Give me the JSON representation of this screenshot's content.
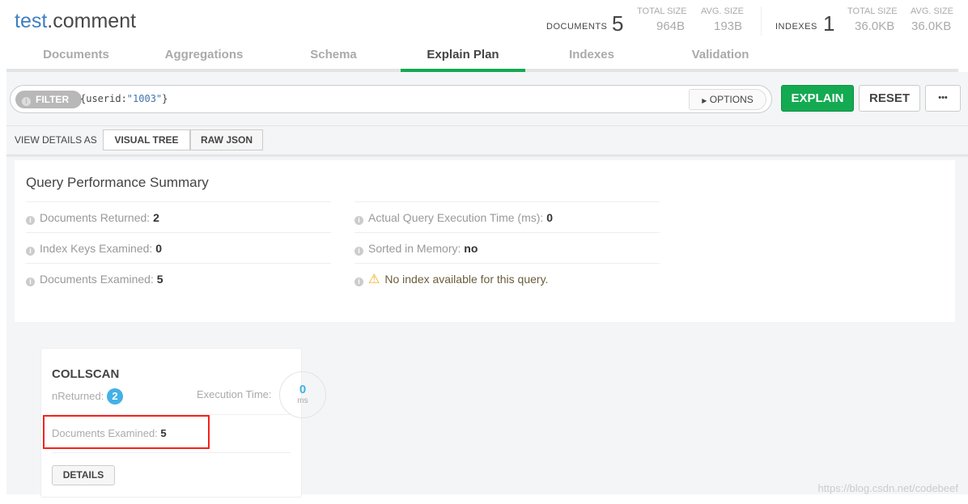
{
  "header": {
    "db": "test",
    "collection": ".comment",
    "documents": {
      "label": "DOCUMENTS",
      "count": "5",
      "total_size_label": "TOTAL SIZE",
      "total_size": "964B",
      "avg_size_label": "AVG. SIZE",
      "avg_size": "193B"
    },
    "indexes": {
      "label": "INDEXES",
      "count": "1",
      "total_size_label": "TOTAL SIZE",
      "total_size": "36.0KB",
      "avg_size_label": "AVG. SIZE",
      "avg_size": "36.0KB"
    }
  },
  "tabs": [
    {
      "label": "Documents"
    },
    {
      "label": "Aggregations"
    },
    {
      "label": "Schema"
    },
    {
      "label": "Explain Plan",
      "active": true
    },
    {
      "label": "Indexes"
    },
    {
      "label": "Validation"
    }
  ],
  "filter": {
    "badge": "FILTER",
    "value_pre": "{userid:",
    "value_str": "\"1003\"",
    "value_post": "}",
    "options": "OPTIONS"
  },
  "buttons": {
    "explain": "EXPLAIN",
    "reset": "RESET",
    "more": "•••"
  },
  "view": {
    "label": "VIEW DETAILS AS",
    "visual_tree": "VISUAL TREE",
    "raw_json": "RAW JSON"
  },
  "summary": {
    "title": "Query Performance Summary",
    "left": [
      {
        "label": "Documents Returned:",
        "value": "2"
      },
      {
        "label": "Index Keys Examined:",
        "value": "0"
      },
      {
        "label": "Documents Examined:",
        "value": "5"
      }
    ],
    "right": [
      {
        "label": "Actual Query Execution Time (ms):",
        "value": "0"
      },
      {
        "label": "Sorted in Memory:",
        "value": "no"
      }
    ],
    "warning": "No index available for this query."
  },
  "stage": {
    "name": "COLLSCAN",
    "nreturned_label": "nReturned:",
    "nreturned": "2",
    "exec_label": "Execution Time:",
    "exec_value": "0",
    "exec_unit": "ms",
    "docs_examined_label": "Documents Examined:",
    "docs_examined": "5",
    "details": "DETAILS"
  },
  "watermark": "https://blog.csdn.net/codebeef",
  "colors": {
    "accent": "#13aa52",
    "db": "#3f7fbf",
    "badge": "#43b1e5",
    "highlight": "#f5211d"
  }
}
